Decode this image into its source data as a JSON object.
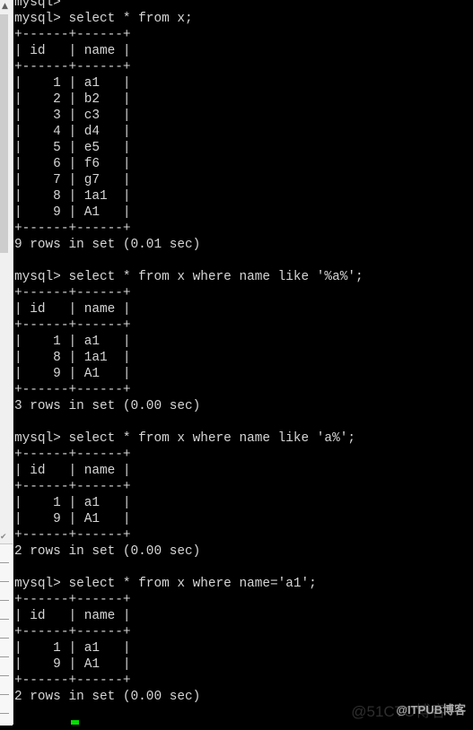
{
  "terminal": {
    "lines": [
      "mysql>",
      "mysql> select * from x;",
      "+------+------+",
      "| id   | name |",
      "+------+------+",
      "|    1 | a1   |",
      "|    2 | b2   |",
      "|    3 | c3   |",
      "|    4 | d4   |",
      "|    5 | e5   |",
      "|    6 | f6   |",
      "|    7 | g7   |",
      "|    8 | 1a1  |",
      "|    9 | A1   |",
      "+------+------+",
      "9 rows in set (0.01 sec)",
      "",
      "mysql> select * from x where name like '%a%';",
      "+------+------+",
      "| id   | name |",
      "+------+------+",
      "|    1 | a1   |",
      "|    8 | 1a1  |",
      "|    9 | A1   |",
      "+------+------+",
      "3 rows in set (0.00 sec)",
      "",
      "mysql> select * from x where name like 'a%';",
      "+------+------+",
      "| id   | name |",
      "+------+------+",
      "|    1 | a1   |",
      "|    9 | A1   |",
      "+------+------+",
      "2 rows in set (0.00 sec)",
      "",
      "mysql> select * from x where name='a1';",
      "+------+------+",
      "| id   | name |",
      "+------+------+",
      "|    1 | a1   |",
      "|    9 | A1   |",
      "+------+------+",
      "2 rows in set (0.00 sec)",
      ""
    ],
    "cursor_color": "#00e000",
    "text_color": "#d6d6d6",
    "background": "#000000"
  },
  "side_panel": {
    "scroll_up_icon": "▲",
    "check_icon": "✔"
  },
  "watermark": {
    "text": "@ITPUB博客",
    "ghost_text": "@51CTO博客"
  }
}
